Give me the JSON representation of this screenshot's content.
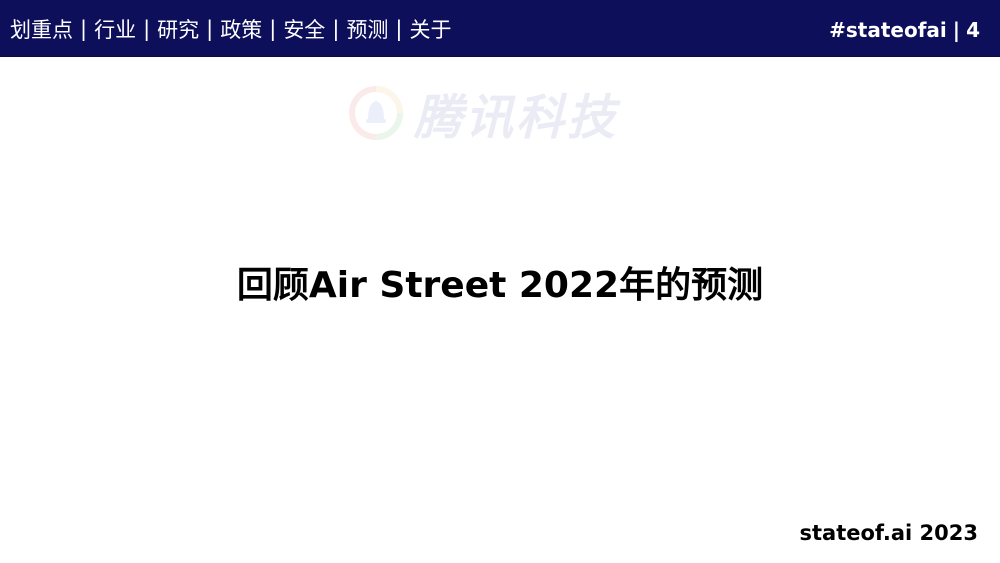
{
  "header": {
    "nav_items": [
      "划重点",
      "行业",
      "研究",
      "政策",
      "安全",
      "预测",
      "关于"
    ],
    "separator": "|",
    "hashtag": "#stateofai",
    "tag_separator": "|",
    "page_number": "4",
    "background_color": "#0d0f5a"
  },
  "watermark": {
    "text": "腾讯科技",
    "icon": "tencent-tech-logo-icon"
  },
  "main": {
    "title": "回顾Air Street 2022年的预测"
  },
  "footer": {
    "text": "stateof.ai 2023"
  }
}
